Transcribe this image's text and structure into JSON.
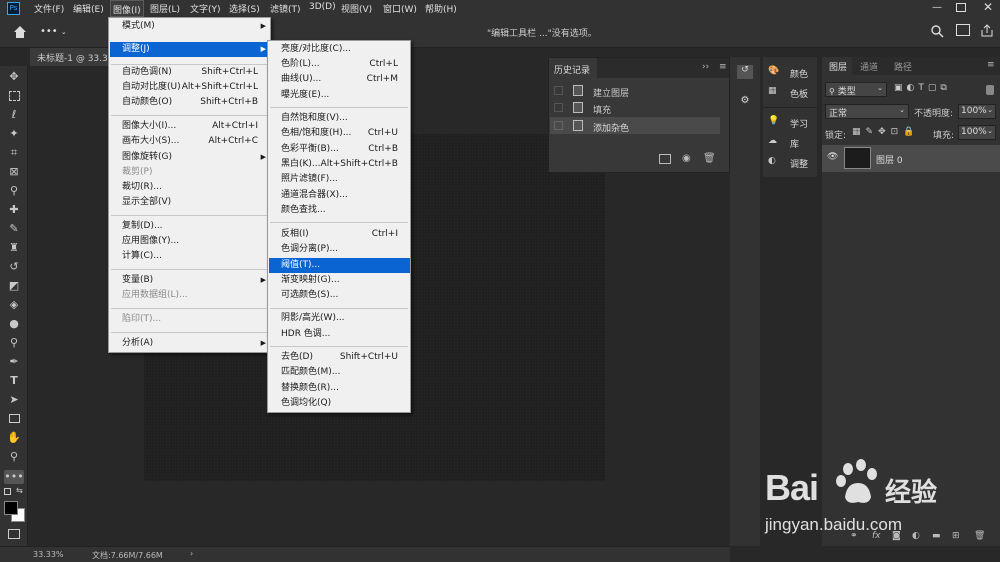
{
  "app": {
    "logo": "Ps",
    "colors": {
      "accent": "#0a64d2",
      "panel": "#323232",
      "canvas": "#202020"
    }
  },
  "menubar": {
    "items": [
      "文件(F)",
      "编辑(E)",
      "图像(I)",
      "图层(L)",
      "文字(Y)",
      "选择(S)",
      "滤镜(T)",
      "3D(D)",
      "视图(V)",
      "窗口(W)",
      "帮助(H)"
    ]
  },
  "optionsbar": {
    "message": "\"编辑工具栏 ...\"没有选项。",
    "more": "•••"
  },
  "document": {
    "tab": "未标题-1 @ 33.3",
    "zoom": "33.33%",
    "doc_size": "文档:7.66M/7.66M"
  },
  "image_menu": {
    "items": [
      {
        "label": "模式(M)",
        "shortcut": "",
        "sub": true
      },
      {
        "label": "调整(J)",
        "shortcut": "",
        "sub": true
      },
      {
        "label": "自动色调(N)",
        "shortcut": "Shift+Ctrl+L"
      },
      {
        "label": "自动对比度(U)",
        "shortcut": "Alt+Shift+Ctrl+L"
      },
      {
        "label": "自动颜色(O)",
        "shortcut": "Shift+Ctrl+B"
      },
      {
        "label": "图像大小(I)...",
        "shortcut": "Alt+Ctrl+I"
      },
      {
        "label": "画布大小(S)...",
        "shortcut": "Alt+Ctrl+C"
      },
      {
        "label": "图像旋转(G)",
        "shortcut": "",
        "sub": true
      },
      {
        "label": "裁剪(P)",
        "shortcut": ""
      },
      {
        "label": "裁切(R)...",
        "shortcut": ""
      },
      {
        "label": "显示全部(V)",
        "shortcut": ""
      },
      {
        "label": "复制(D)...",
        "shortcut": ""
      },
      {
        "label": "应用图像(Y)...",
        "shortcut": ""
      },
      {
        "label": "计算(C)...",
        "shortcut": ""
      },
      {
        "label": "变量(B)",
        "shortcut": "",
        "sub": true
      },
      {
        "label": "应用数据组(L)...",
        "shortcut": ""
      },
      {
        "label": "陷印(T)...",
        "shortcut": ""
      },
      {
        "label": "分析(A)",
        "shortcut": "",
        "sub": true
      }
    ]
  },
  "adjust_menu": {
    "items": [
      {
        "label": "亮度/对比度(C)...",
        "shortcut": ""
      },
      {
        "label": "色阶(L)...",
        "shortcut": "Ctrl+L"
      },
      {
        "label": "曲线(U)...",
        "shortcut": "Ctrl+M"
      },
      {
        "label": "曝光度(E)...",
        "shortcut": ""
      },
      {
        "label": "自然饱和度(V)...",
        "shortcut": ""
      },
      {
        "label": "色相/饱和度(H)...",
        "shortcut": "Ctrl+U"
      },
      {
        "label": "色彩平衡(B)...",
        "shortcut": "Ctrl+B"
      },
      {
        "label": "黑白(K)...",
        "shortcut": "Alt+Shift+Ctrl+B"
      },
      {
        "label": "照片滤镜(F)...",
        "shortcut": ""
      },
      {
        "label": "通道混合器(X)...",
        "shortcut": ""
      },
      {
        "label": "颜色查找...",
        "shortcut": ""
      },
      {
        "label": "反相(I)",
        "shortcut": "Ctrl+I"
      },
      {
        "label": "色调分离(P)...",
        "shortcut": ""
      },
      {
        "label": "阈值(T)...",
        "shortcut": ""
      },
      {
        "label": "渐变映射(G)...",
        "shortcut": ""
      },
      {
        "label": "可选颜色(S)...",
        "shortcut": ""
      },
      {
        "label": "阴影/高光(W)...",
        "shortcut": ""
      },
      {
        "label": "HDR 色调...",
        "shortcut": ""
      },
      {
        "label": "去色(D)",
        "shortcut": "Shift+Ctrl+U"
      },
      {
        "label": "匹配颜色(M)...",
        "shortcut": ""
      },
      {
        "label": "替换颜色(R)...",
        "shortcut": ""
      },
      {
        "label": "色调均化(Q)",
        "shortcut": ""
      }
    ]
  },
  "history": {
    "title": "历史记录",
    "items": [
      "建立图层",
      "填充",
      "添加杂色"
    ]
  },
  "mini_panels": {
    "items": [
      "颜色",
      "色板",
      "学习",
      "库",
      "调整"
    ]
  },
  "layers": {
    "tabs": [
      "图层",
      "通道",
      "路径"
    ],
    "filter": "类型",
    "blend": "正常",
    "opacity_label": "不透明度:",
    "opacity": "100%",
    "lock_label": "锁定:",
    "fill_label": "填充:",
    "fill": "100%",
    "layer_name": "图层 0"
  },
  "watermark": {
    "brand": "Bai",
    "brand2": "经验",
    "url": "jingyan.baidu.com"
  }
}
